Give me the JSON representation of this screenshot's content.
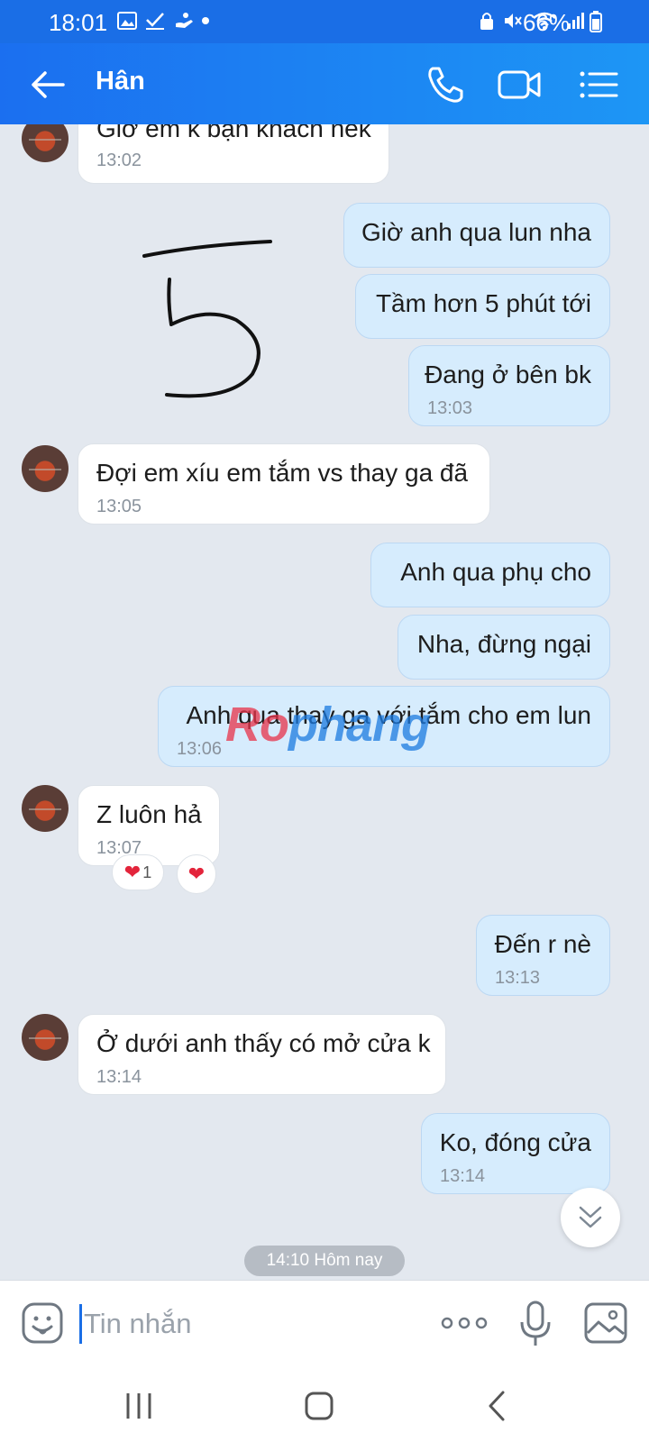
{
  "status_bar": {
    "time": "18:01",
    "battery": "66%",
    "icons_left": [
      "image-icon",
      "check-icon",
      "hand-icon",
      "dot-icon"
    ],
    "icons_right": [
      "lock-icon",
      "mute-icon",
      "wifi-icon",
      "signal-icon",
      "battery-icon"
    ]
  },
  "header": {
    "contact_name": "Hân",
    "actions": [
      "phone-icon",
      "video-call-icon",
      "menu-list-icon"
    ],
    "colors": {
      "start": "#1b6ff0",
      "end": "#1d96f5"
    }
  },
  "messages": [
    {
      "dir": "in",
      "text": "Giờ em k bận khách nek",
      "time": "13:02",
      "avatar": true
    },
    {
      "dir": "out",
      "text": "Giờ anh qua lun nha",
      "time": ""
    },
    {
      "dir": "out",
      "text": "Tầm hơn 5 phút tới",
      "time": ""
    },
    {
      "dir": "out",
      "text": "Đang ở bên bk",
      "time": "13:03"
    },
    {
      "dir": "in",
      "text": "Đợi em xíu em tắm vs thay ga đã",
      "time": "13:05",
      "avatar": true
    },
    {
      "dir": "out",
      "text": "Anh qua phụ cho",
      "time": ""
    },
    {
      "dir": "out",
      "text": "Nha, đừng ngại",
      "time": ""
    },
    {
      "dir": "out",
      "text": "Anh qua thay ga với tắm cho em lun",
      "time": "13:06"
    },
    {
      "dir": "in",
      "text": "Z luôn hả",
      "time": "13:07",
      "avatar": true
    },
    {
      "dir": "out",
      "text": "Đến r nè",
      "time": "13:13"
    },
    {
      "dir": "in",
      "text": "Ở dưới anh thấy có mở cửa k",
      "time": "13:14",
      "avatar": true
    },
    {
      "dir": "out",
      "text": "Ko, đóng cửa",
      "time": "13:14"
    }
  ],
  "reactions": {
    "count": "1",
    "icon": "heart-icon"
  },
  "handwriting": "5",
  "watermark": {
    "part1": "Ro",
    "part2": "phang"
  },
  "day_separator": "14:10 Hôm nay",
  "input": {
    "placeholder": "Tin nhắn"
  },
  "accent_color": "#1a6ee6"
}
